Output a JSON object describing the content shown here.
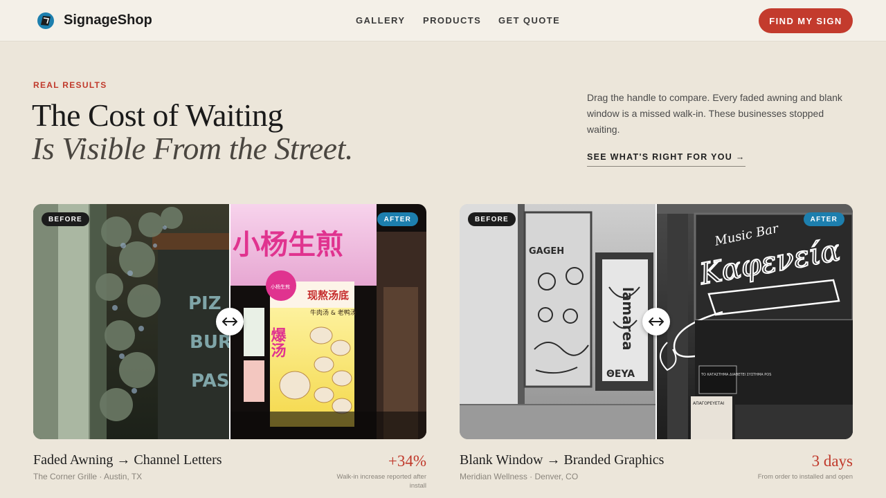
{
  "nav": {
    "brand": "SignageShop",
    "links": [
      "GALLERY",
      "PRODUCTS",
      "GET QUOTE"
    ],
    "cta": "FIND MY SIGN"
  },
  "hero": {
    "eyebrow": "REAL RESULTS",
    "title_line1": "The Cost of Waiting",
    "title_line2": "Is Visible From the Street.",
    "intro": "Drag the handle to compare. Every faded awning and blank window is a missed walk-in. These businesses stopped waiting.",
    "link": "SEE WHAT'S RIGHT FOR YOU →"
  },
  "comparisons": [
    {
      "before_badge": "BEFORE",
      "after_badge": "AFTER",
      "title": "Faded Awning → Channel Letters",
      "subtitle": "The Corner Grille · Austin, TX",
      "stat": "+34%",
      "stat_caption": "Walk-in increase reported after install",
      "slider_position": 0.5,
      "scene": {
        "before_sign_letters": [
          "PIZ",
          "BUR",
          "PAST"
        ],
        "after_sign_text": "小杨生煎",
        "after_menu_header": "现熬汤底",
        "after_menu_sub": "牛肉汤 & 老鸭汤",
        "after_menu_big": "爆汤",
        "after_logo": "小杨生煎"
      }
    },
    {
      "before_badge": "BEFORE",
      "after_badge": "AFTER",
      "title": "Blank Window → Branded Graphics",
      "subtitle": "Meridian Wellness · Denver, CO",
      "stat": "3 days",
      "stat_caption": "From order to installed and open",
      "slider_position": 0.5,
      "scene": {
        "before_graffiti": [
          "GAGEH",
          "lamarea",
          "ΘEYA"
        ],
        "after_script_top": "Music Bar",
        "after_script_main": "Καφενεία",
        "after_notice_1": "ΤΟ ΚΑΤΑΣΤΗΜΑ ΔΙΑΘΕΤΕΙ ΣΥΣΤΗΜΑ POS",
        "after_notice_2": "ΑΠΑΓΟΡΕΥΕΤΑΙ"
      }
    }
  ],
  "colors": {
    "background": "#ece6da",
    "accent_red": "#c33b2d",
    "after_badge_blue": "#1d7fae",
    "before_badge_dark": "#1c1c1c"
  },
  "icons": {
    "logo": "signage-logo-icon",
    "slider_handle": "left-right-arrows-icon"
  }
}
